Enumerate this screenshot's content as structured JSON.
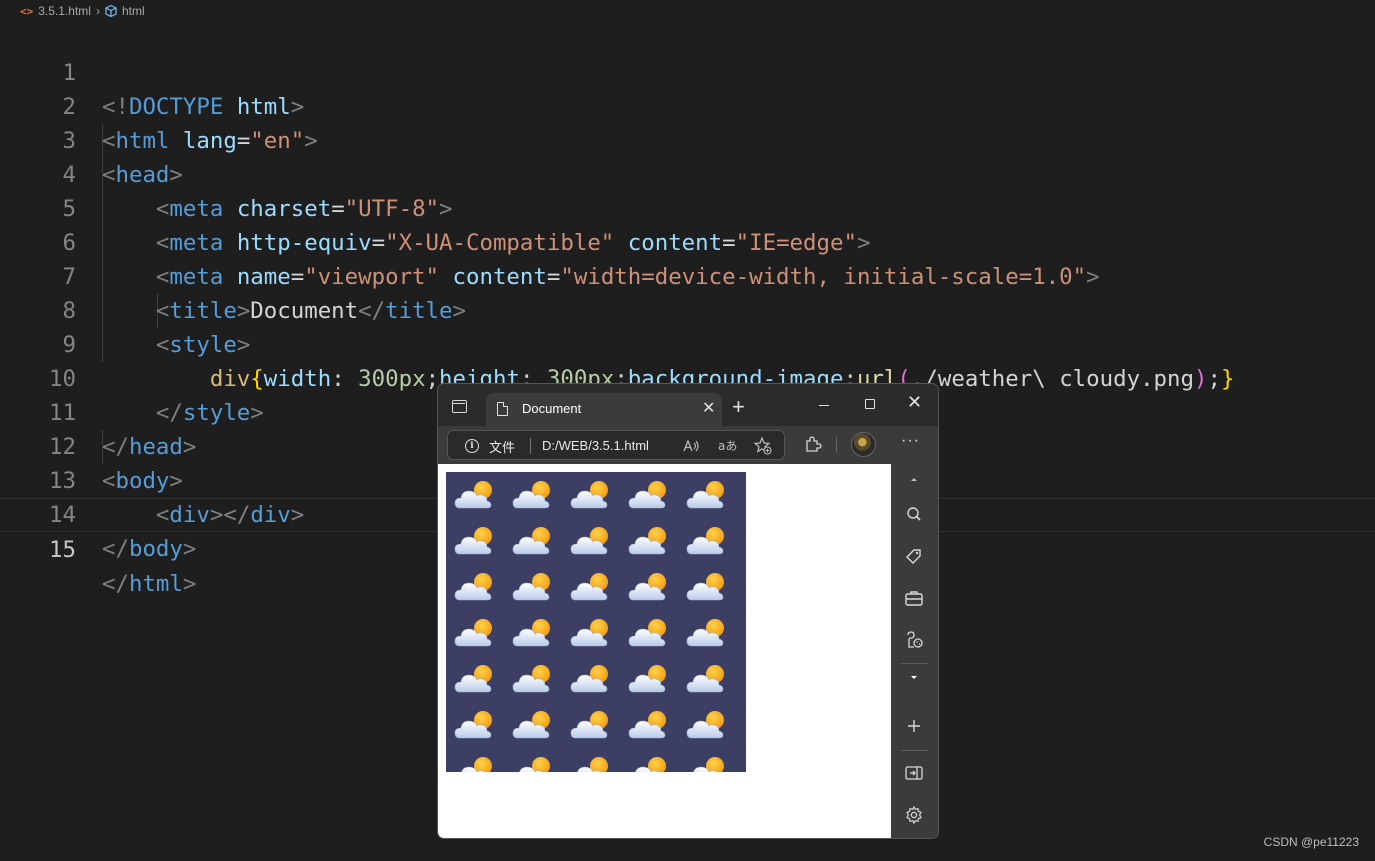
{
  "breadcrumb": {
    "file": "3.5.1.html",
    "symbol": "html"
  },
  "editor": {
    "lines": [
      {
        "n": "1"
      },
      {
        "n": "2"
      },
      {
        "n": "3"
      },
      {
        "n": "4"
      },
      {
        "n": "5"
      },
      {
        "n": "6"
      },
      {
        "n": "7"
      },
      {
        "n": "8"
      },
      {
        "n": "9"
      },
      {
        "n": "10"
      },
      {
        "n": "11"
      },
      {
        "n": "12"
      },
      {
        "n": "13"
      },
      {
        "n": "14"
      },
      {
        "n": "15"
      }
    ],
    "active_line": "15",
    "tokens": {
      "doctype": "DOCTYPE",
      "html": "html",
      "head": "head",
      "meta": "meta",
      "title": "title",
      "style": "style",
      "body": "body",
      "div": "div",
      "lang": "lang",
      "en": "\"en\"",
      "charset": "charset",
      "utf8": "\"UTF-8\"",
      "http_equiv": "http-equiv",
      "xua": "\"X-UA-Compatible\"",
      "content": "content",
      "ieedge": "\"IE=edge\"",
      "name": "name",
      "viewport": "\"viewport\"",
      "viewport_content": "\"width=device-width, initial-scale=1.0\"",
      "document": "Document",
      "prop_width": "width",
      "prop_height": "height",
      "val_300": "300px",
      "prop_bg": "background-image",
      "url_fn": "url",
      "url_path": "./weather\\ cloudy.png"
    }
  },
  "browser": {
    "tab_title": "Document",
    "address_label": "文件",
    "address_url": "D:/WEB/3.5.1.html",
    "colors": {
      "div_background": "#3d3e63"
    },
    "weather_grid": {
      "cols": 5,
      "rows": 7,
      "icon": "weather-cloudy-icon"
    }
  },
  "watermark": "CSDN @pe11223"
}
